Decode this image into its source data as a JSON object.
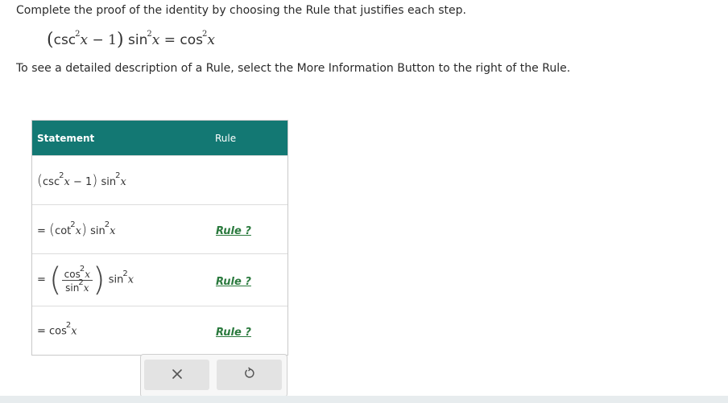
{
  "instruction_top": "Complete the proof of the identity by choosing the Rule that justifies each step.",
  "instruction_info": "To see a detailed description of a Rule, select the More Information Button to the right of the Rule.",
  "identity": {
    "lhs_fn": "csc",
    "exp": "2",
    "var": "x",
    "minus_one": "− 1",
    "sin": "sin",
    "eq": "=",
    "cos": "cos"
  },
  "table": {
    "headers": {
      "statement": "Statement",
      "rule": "Rule"
    },
    "rows": [
      {
        "statement": "(csc²x − 1) sin²x",
        "rule": ""
      },
      {
        "statement": "= (cot²x) sin²x",
        "rule": "Rule ?"
      },
      {
        "statement": "= (cos²x / sin²x) sin²x",
        "rule": "Rule ?"
      },
      {
        "statement": "= cos²x",
        "rule": "Rule ?"
      }
    ]
  },
  "buttons": {
    "clear": "close-icon",
    "reset": "undo-icon"
  },
  "colors": {
    "header_bg": "#137873",
    "rule_link": "#2b7a3e"
  }
}
